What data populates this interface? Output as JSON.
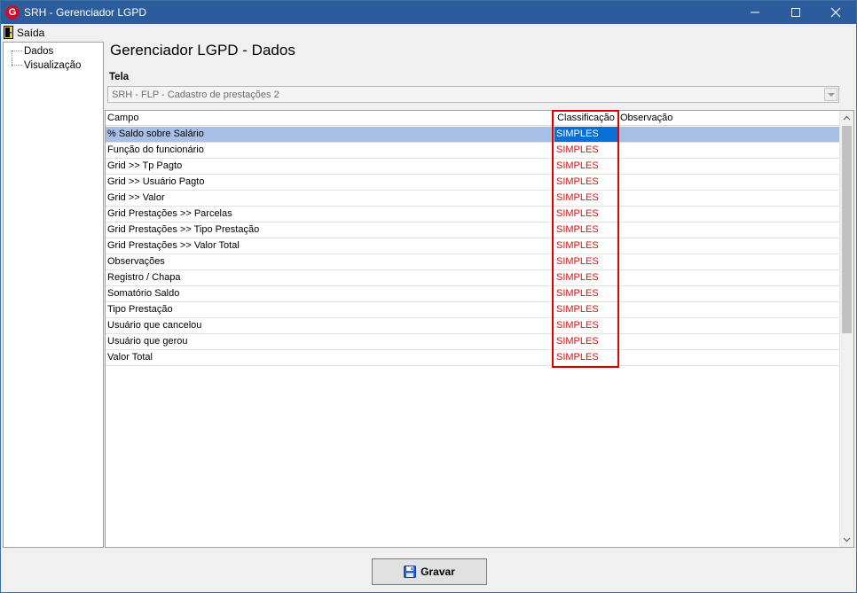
{
  "window": {
    "title": "SRH - Gerenciador LGPD",
    "icon_letter": "G"
  },
  "menu": {
    "exit_label": "Saída"
  },
  "tree": {
    "items": [
      {
        "label": "Dados"
      },
      {
        "label": "Visualização"
      }
    ]
  },
  "main": {
    "title": "Gerenciador LGPD - Dados",
    "tela_label": "Tela",
    "tela_value": "SRH - FLP - Cadastro de prestações 2"
  },
  "grid": {
    "columns": [
      "Campo",
      "Classificação",
      "Observação"
    ],
    "rows": [
      {
        "campo": "% Saldo sobre Salário",
        "classificacao": "SIMPLES",
        "observacao": ""
      },
      {
        "campo": "Função do funcionário",
        "classificacao": "SIMPLES",
        "observacao": ""
      },
      {
        "campo": "Grid >> Tp Pagto",
        "classificacao": "SIMPLES",
        "observacao": ""
      },
      {
        "campo": "Grid >> Usuário Pagto",
        "classificacao": "SIMPLES",
        "observacao": ""
      },
      {
        "campo": "Grid >> Valor",
        "classificacao": "SIMPLES",
        "observacao": ""
      },
      {
        "campo": "Grid Prestações >> Parcelas",
        "classificacao": "SIMPLES",
        "observacao": ""
      },
      {
        "campo": "Grid Prestações >> Tipo Prestação",
        "classificacao": "SIMPLES",
        "observacao": ""
      },
      {
        "campo": "Grid Prestações >> Valor Total",
        "classificacao": "SIMPLES",
        "observacao": ""
      },
      {
        "campo": "Observações",
        "classificacao": "SIMPLES",
        "observacao": ""
      },
      {
        "campo": "Registro / Chapa",
        "classificacao": "SIMPLES",
        "observacao": ""
      },
      {
        "campo": "Somatório Saldo",
        "classificacao": "SIMPLES",
        "observacao": ""
      },
      {
        "campo": "Tipo Prestação",
        "classificacao": "SIMPLES",
        "observacao": ""
      },
      {
        "campo": "Usuário que cancelou",
        "classificacao": "SIMPLES",
        "observacao": ""
      },
      {
        "campo": "Usuário que gerou",
        "classificacao": "SIMPLES",
        "observacao": ""
      },
      {
        "campo": "Valor Total",
        "classificacao": "SIMPLES",
        "observacao": ""
      }
    ],
    "selected_row_index": 0
  },
  "footer": {
    "save_label": "Gravar"
  },
  "colors": {
    "titlebar": "#2b5d9c",
    "classification_text": "#e01010",
    "selected_row": "#a8bfe6",
    "selected_cell": "#0a6fd6",
    "highlight_border": "#e00000"
  },
  "icons": {
    "app": "app-logo-icon",
    "exit": "door-exit-icon",
    "save": "floppy-disk-icon"
  }
}
